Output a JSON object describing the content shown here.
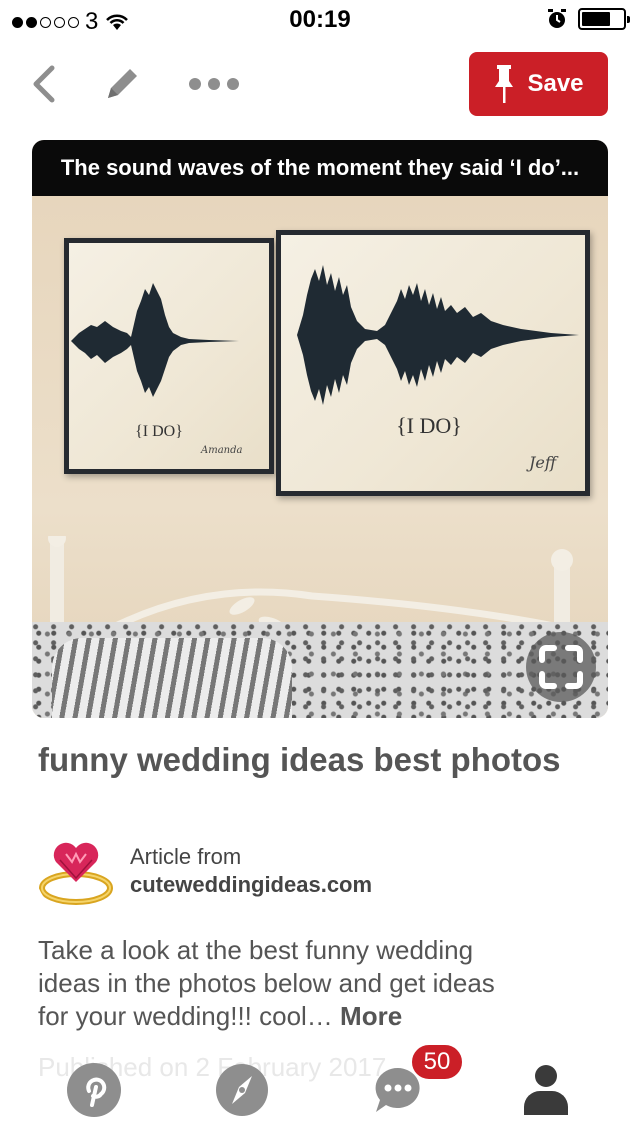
{
  "status_bar": {
    "carrier": "3",
    "time": "00:19"
  },
  "toolbar": {
    "save_label": "Save"
  },
  "pin": {
    "image_caption": "The sound waves of the moment they said ‘I do’...",
    "left_panel_text": "{I DO}",
    "left_signature": "Amanda",
    "right_panel_text": "{I DO}",
    "right_signature": "Jeff",
    "title": "funny wedding ideas best photos",
    "source_label": "Article from",
    "source_domain": "cuteweddingideas.com",
    "description": "Take a look at the best funny wedding ideas in the photos below and get ideas for your wedding!!! cool…",
    "more_label": "More",
    "published": "Published on 2 February 2017"
  },
  "tabbar": {
    "notification_count": "50"
  },
  "colors": {
    "brand_red": "#cb1f27",
    "icon_gray": "#8e8e8e",
    "text_gray": "#555555"
  },
  "icons": [
    "back-icon",
    "edit-icon",
    "more-icon",
    "pin-icon",
    "expand-icon",
    "pinterest-icon",
    "explore-icon",
    "messages-icon",
    "profile-icon"
  ]
}
